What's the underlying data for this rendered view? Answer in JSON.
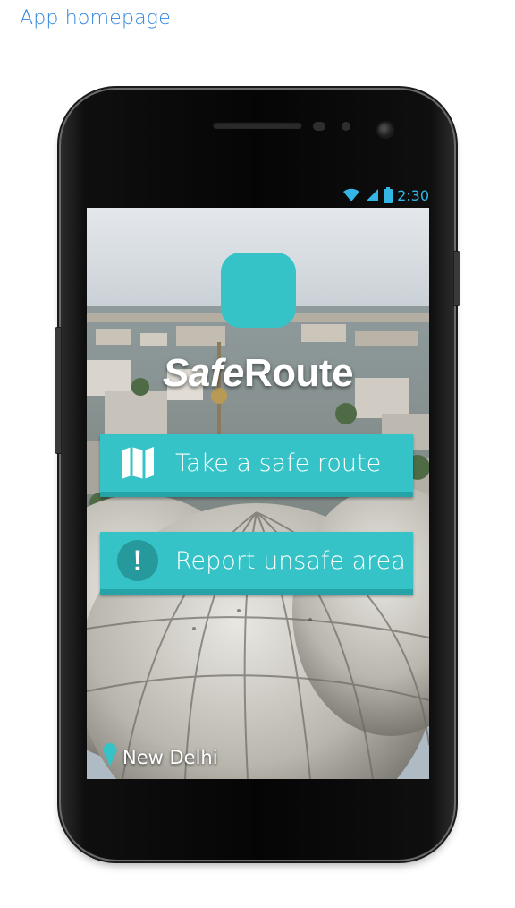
{
  "caption": "App homepage",
  "status_bar": {
    "time": "2:30",
    "icons": [
      "wifi-icon",
      "signal-icon",
      "battery-icon"
    ],
    "color": "#33b5e5"
  },
  "app": {
    "title_italic": "Safe",
    "title_rest": "Route",
    "accent_color": "#35c3c7"
  },
  "menu": [
    {
      "label": "Take a safe route",
      "icon": "map-icon"
    },
    {
      "label": "Report unsafe area",
      "icon": "exclamation-icon",
      "icon_glyph": "!"
    }
  ],
  "location": {
    "name": "New Delhi",
    "icon": "location-pin-icon"
  }
}
